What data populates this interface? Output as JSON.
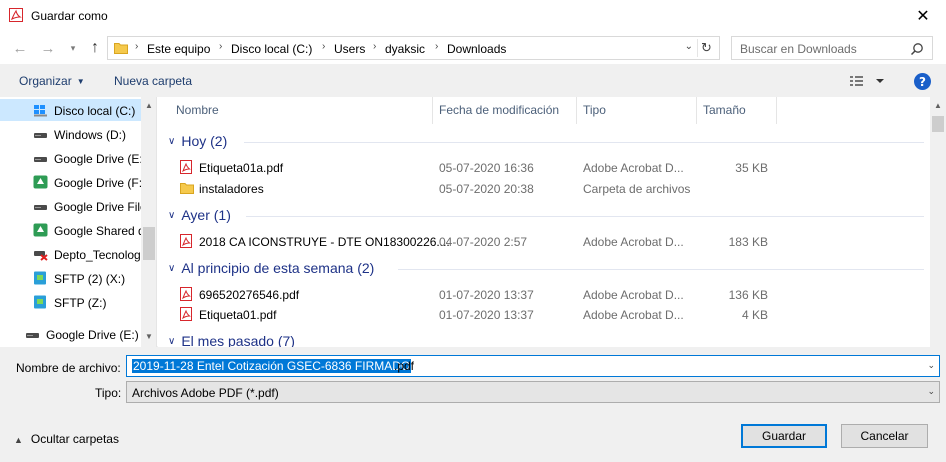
{
  "window": {
    "title": "Guardar como",
    "close_glyph": "✕",
    "title_icon": "adobe-pdf-icon"
  },
  "nav": {
    "back_glyph": "←",
    "forward_glyph": "→",
    "recent_glyph": "▾",
    "up_glyph": "↑"
  },
  "address": {
    "breadcrumbs": [
      "Este equipo",
      "Disco local (C:)",
      "Users",
      "dyaksic",
      "Downloads"
    ],
    "sep_glyph": "›",
    "drop_glyph": "⌄",
    "refresh_glyph": "↻"
  },
  "search": {
    "placeholder": "Buscar en Downloads"
  },
  "toolbar": {
    "organize_label": "Organizar",
    "organize_caret": "▼",
    "new_folder_label": "Nueva carpeta",
    "help_label": "?"
  },
  "sidebar": {
    "up_glyph": "▲",
    "down_glyph": "▼",
    "items": [
      {
        "label": "Disco local (C:)",
        "icon": "windows-drive-icon",
        "selected": true
      },
      {
        "label": "Windows (D:)",
        "icon": "drive-icon"
      },
      {
        "label": "Google Drive (E:)",
        "icon": "drive-icon"
      },
      {
        "label": "Google Drive (F:)",
        "icon": "google-drive-icon"
      },
      {
        "label": "Google Drive File",
        "icon": "drive-icon"
      },
      {
        "label": "Google Shared d",
        "icon": "google-drive-icon"
      },
      {
        "label": "Depto_Tecnolog",
        "icon": "network-drive-disconnected-icon"
      },
      {
        "label": "SFTP (2) (X:)",
        "icon": "sftp-drive-icon"
      },
      {
        "label": "SFTP (Z:)",
        "icon": "sftp-drive-icon"
      },
      {
        "label": "Google Drive (E:)",
        "icon": "drive-icon"
      }
    ]
  },
  "columns": {
    "name": "Nombre",
    "date": "Fecha de modificación",
    "type": "Tipo",
    "size": "Tamaño"
  },
  "groups": [
    {
      "label": "Hoy (2)",
      "files": [
        {
          "name": "Etiqueta01a.pdf",
          "date": "05-07-2020 16:36",
          "type": "Adobe Acrobat D...",
          "size": "35 KB",
          "icon": "pdf-file-icon"
        },
        {
          "name": "instaladores",
          "date": "05-07-2020 20:38",
          "type": "Carpeta de archivos",
          "size": "",
          "icon": "folder-icon"
        }
      ]
    },
    {
      "label": "Ayer (1)",
      "files": [
        {
          "name": "2018 CA ICONSTRUYE - DTE ON18300226....",
          "date": "04-07-2020 2:57",
          "type": "Adobe Acrobat D...",
          "size": "183 KB",
          "icon": "pdf-file-icon"
        }
      ]
    },
    {
      "label": "Al principio de esta semana (2)",
      "files": [
        {
          "name": "696520276546.pdf",
          "date": "01-07-2020 13:37",
          "type": "Adobe Acrobat D...",
          "size": "136 KB",
          "icon": "pdf-file-icon"
        },
        {
          "name": "Etiqueta01.pdf",
          "date": "01-07-2020 13:37",
          "type": "Adobe Acrobat D...",
          "size": "4 KB",
          "icon": "pdf-file-icon"
        }
      ]
    },
    {
      "label": "El mes pasado (7)",
      "files": []
    }
  ],
  "filename": {
    "label": "Nombre de archivo:",
    "selected_text": "2019-11-28 Entel Cotización GSEC-6836 FIRMADO",
    "extension": ".pdf",
    "drop_glyph": "⌄"
  },
  "filetype": {
    "label": "Tipo:",
    "value": "Archivos Adobe PDF (*.pdf)",
    "drop_glyph": "⌄"
  },
  "footer": {
    "hide_folders_caret": "▲",
    "hide_folders_label": "Ocultar carpetas",
    "save_label": "Guardar",
    "cancel_label": "Cancelar"
  },
  "colors": {
    "accent": "#0078d7",
    "group_header": "#1e3287",
    "selected_bg": "#cce8ff",
    "pdf_red": "#d7262c",
    "folder_yellow": "#f5c94c"
  }
}
